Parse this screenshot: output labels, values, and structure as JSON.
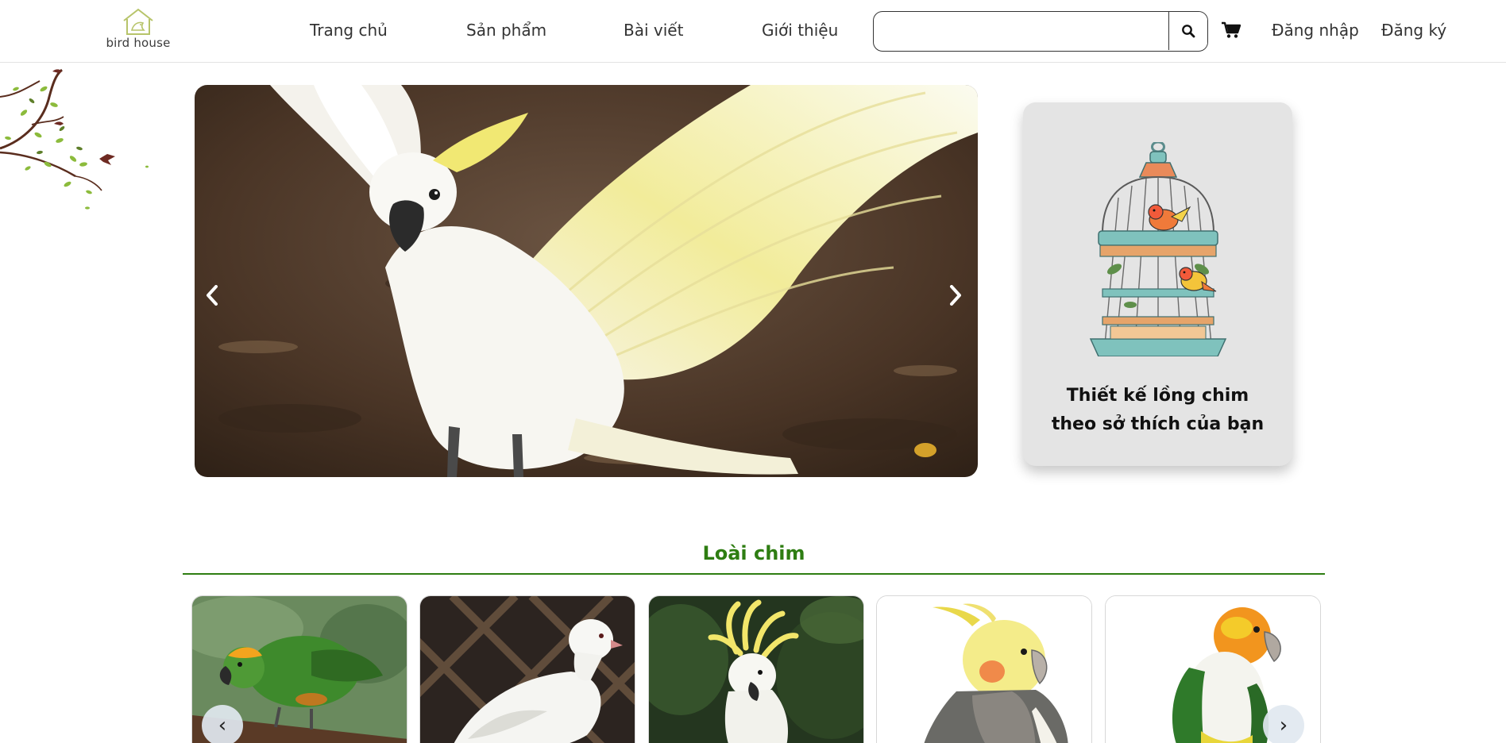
{
  "header": {
    "logo_text": "bird house",
    "nav": [
      "Trang chủ",
      "Sản phẩm",
      "Bài viết",
      "Giới thiệu"
    ],
    "search_value": "",
    "search_placeholder": "",
    "login_label": "Đăng nhập",
    "register_label": "Đăng ký",
    "icons": {
      "search": "search-icon",
      "cart": "cart-icon"
    }
  },
  "hero": {
    "image": "white cockatoo spreading wings",
    "prev_glyph": "chevron-left-icon",
    "next_glyph": "chevron-right-icon"
  },
  "promo": {
    "title": "Thiết kế lồng chim\ntheo sở thích của bạn",
    "image": "bird cage with two birds"
  },
  "species": {
    "title": "Loài chim",
    "accent": "#2e7d12",
    "cards": [
      {
        "image": "green parrot"
      },
      {
        "image": "white dove"
      },
      {
        "image": "cockatoo"
      },
      {
        "image": "cockatiel"
      },
      {
        "image": "caique parrot"
      }
    ],
    "prev_glyph": "‹",
    "next_glyph": "›"
  }
}
